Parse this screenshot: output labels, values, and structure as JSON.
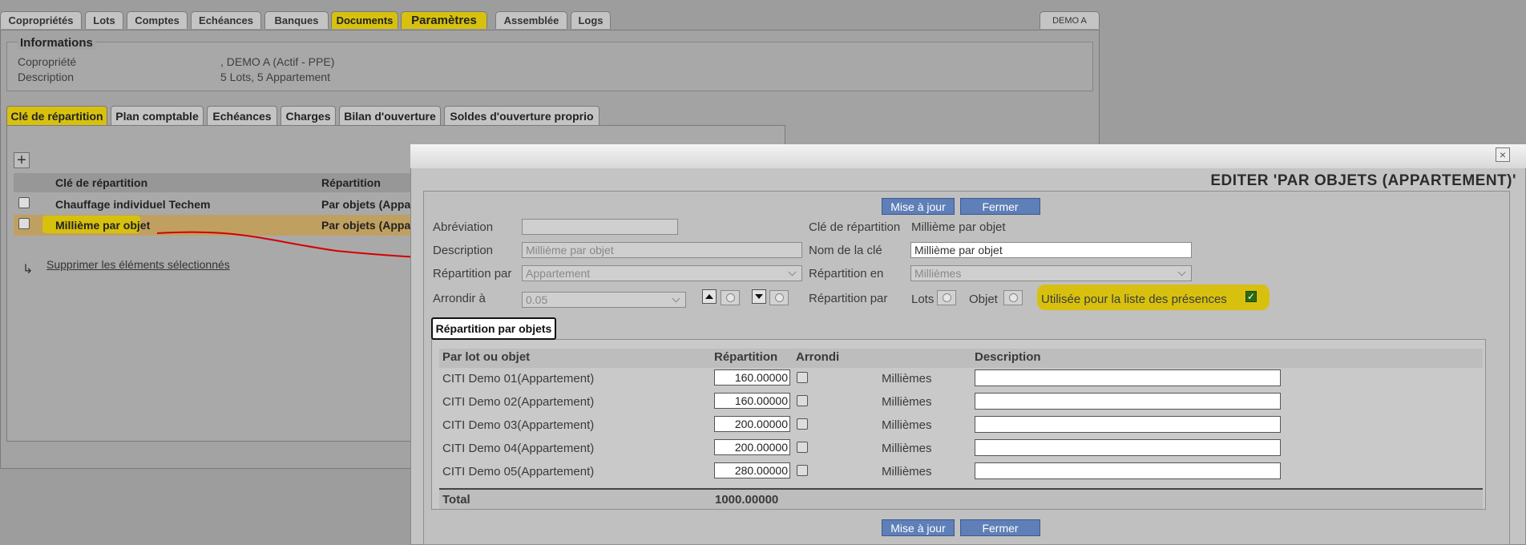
{
  "top_tabs": [
    "Copropriétés",
    "Lots",
    "Comptes",
    "Echéances",
    "Banques",
    "Documents",
    "Paramètres",
    "Assemblée",
    "Logs"
  ],
  "top_tab_right": "DEMO A",
  "info": {
    "title": "Informations",
    "rows": [
      {
        "label": "Copropriété",
        "value": ", DEMO A (Actif - PPE)"
      },
      {
        "label": "Description",
        "value": "5 Lots, 5 Appartement"
      }
    ]
  },
  "sub_tabs": [
    "Clé de répartition",
    "Plan comptable",
    "Echéances",
    "Charges",
    "Bilan d'ouverture",
    "Soldes d'ouverture proprio"
  ],
  "list": {
    "add_label": "+",
    "columns": [
      "Clé de répartition",
      "Répartition"
    ],
    "rows": [
      {
        "name": "Chauffage individuel Techem",
        "repartition": "Par objets (Appa"
      },
      {
        "name": "Millième par objet",
        "repartition": "Par objets (Appa"
      }
    ],
    "delete_label": "Supprimer les éléments sélectionnés"
  },
  "dialog": {
    "close_label": "×",
    "title": "EDITER 'PAR OBJETS (APPARTEMENT)'",
    "update_label": "Mise à jour",
    "close_btn_label": "Fermer",
    "fields": {
      "abreviation_label": "Abréviation",
      "abreviation_value": "",
      "description_label": "Description",
      "description_value": "Millième par objet",
      "repartition_par_label": "Répartition par",
      "repartition_par_value": "Appartement",
      "arrondir_label": "Arrondir à",
      "arrondir_value": "0.05",
      "cle_label": "Clé de répartition",
      "cle_value": "Millième par objet",
      "nom_label": "Nom de la clé",
      "nom_value": "Millième par objet",
      "repartition_en_label": "Répartition en",
      "repartition_en_value": "Millièmes",
      "repartition_par2_label": "Répartition par",
      "lots_label": "Lots",
      "objet_label": "Objet",
      "presence_label": "Utilisée pour la liste des présences"
    },
    "inner_tab": "Répartition par objets",
    "table": {
      "columns": [
        "Par lot ou objet",
        "Répartition",
        "Arrondi",
        "Description"
      ],
      "rows": [
        {
          "name": "CITI Demo 01(Appartement)",
          "value": "160.00000",
          "unit": "Millièmes"
        },
        {
          "name": "CITI Demo 02(Appartement)",
          "value": "160.00000",
          "unit": "Millièmes"
        },
        {
          "name": "CITI Demo 03(Appartement)",
          "value": "200.00000",
          "unit": "Millièmes"
        },
        {
          "name": "CITI Demo 04(Appartement)",
          "value": "200.00000",
          "unit": "Millièmes"
        },
        {
          "name": "CITI Demo 05(Appartement)",
          "value": "280.00000",
          "unit": "Millièmes"
        }
      ],
      "total_label": "Total",
      "total_value": "1000.00000"
    }
  },
  "colors": {
    "highlight": "#d7c10e",
    "button": "#5e7fb7",
    "annotation_arrow": "#d40000"
  }
}
